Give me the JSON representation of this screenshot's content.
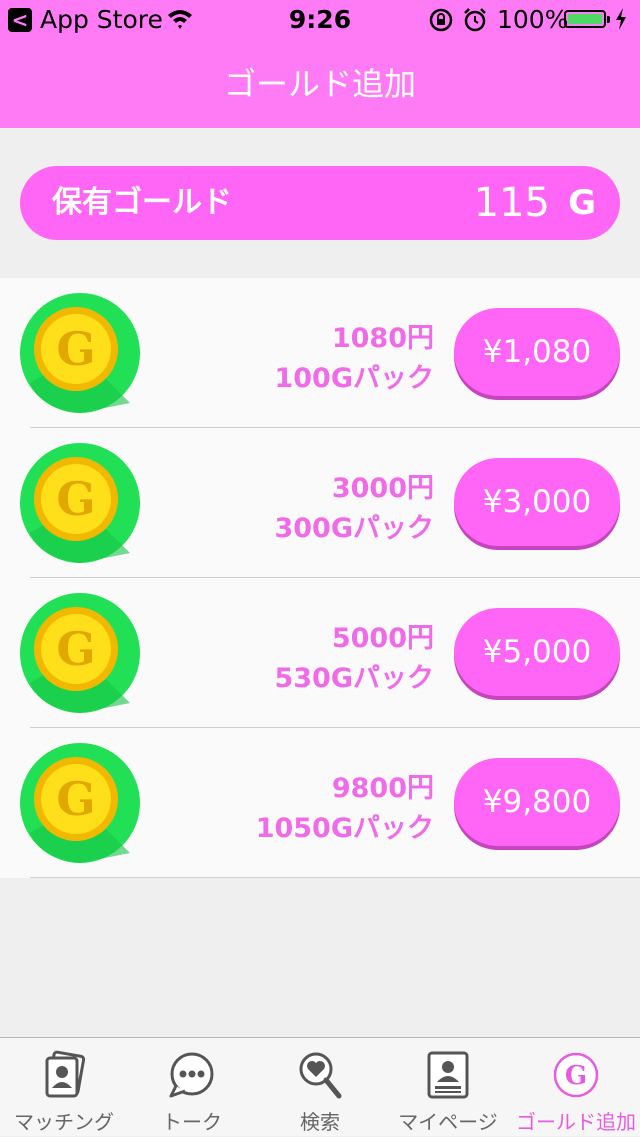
{
  "status_bar": {
    "back_glyph": "<",
    "back_label": "App Store",
    "time": "9:26",
    "battery": "100%",
    "battery_level": 1.0
  },
  "navbar": {
    "title": "ゴールド追加"
  },
  "balance": {
    "label": "保有ゴールド",
    "amount": "115",
    "unit": "G"
  },
  "packs": [
    {
      "price": "1080円",
      "pack": "100Gパック",
      "button": "¥1,080"
    },
    {
      "price": "3000円",
      "pack": "300Gパック",
      "button": "¥3,000"
    },
    {
      "price": "5000円",
      "pack": "530Gパック",
      "button": "¥5,000"
    },
    {
      "price": "9800円",
      "pack": "1050Gパック",
      "button": "¥9,800"
    }
  ],
  "coin_letter": "G",
  "tabs": [
    {
      "label": "マッチング",
      "icon": "matching-card-icon"
    },
    {
      "label": "トーク",
      "icon": "chat-bubble-icon"
    },
    {
      "label": "検索",
      "icon": "heart-search-icon"
    },
    {
      "label": "マイページ",
      "icon": "profile-card-icon"
    },
    {
      "label": "ゴールド追加",
      "icon": "gold-coin-icon",
      "active": true
    }
  ],
  "colors": {
    "accent": "#ff66f5",
    "nav": "#ff7bf6",
    "text_accent": "#f06be8",
    "coin_ring": "#22e055",
    "coin_gold": "#ffd400"
  }
}
